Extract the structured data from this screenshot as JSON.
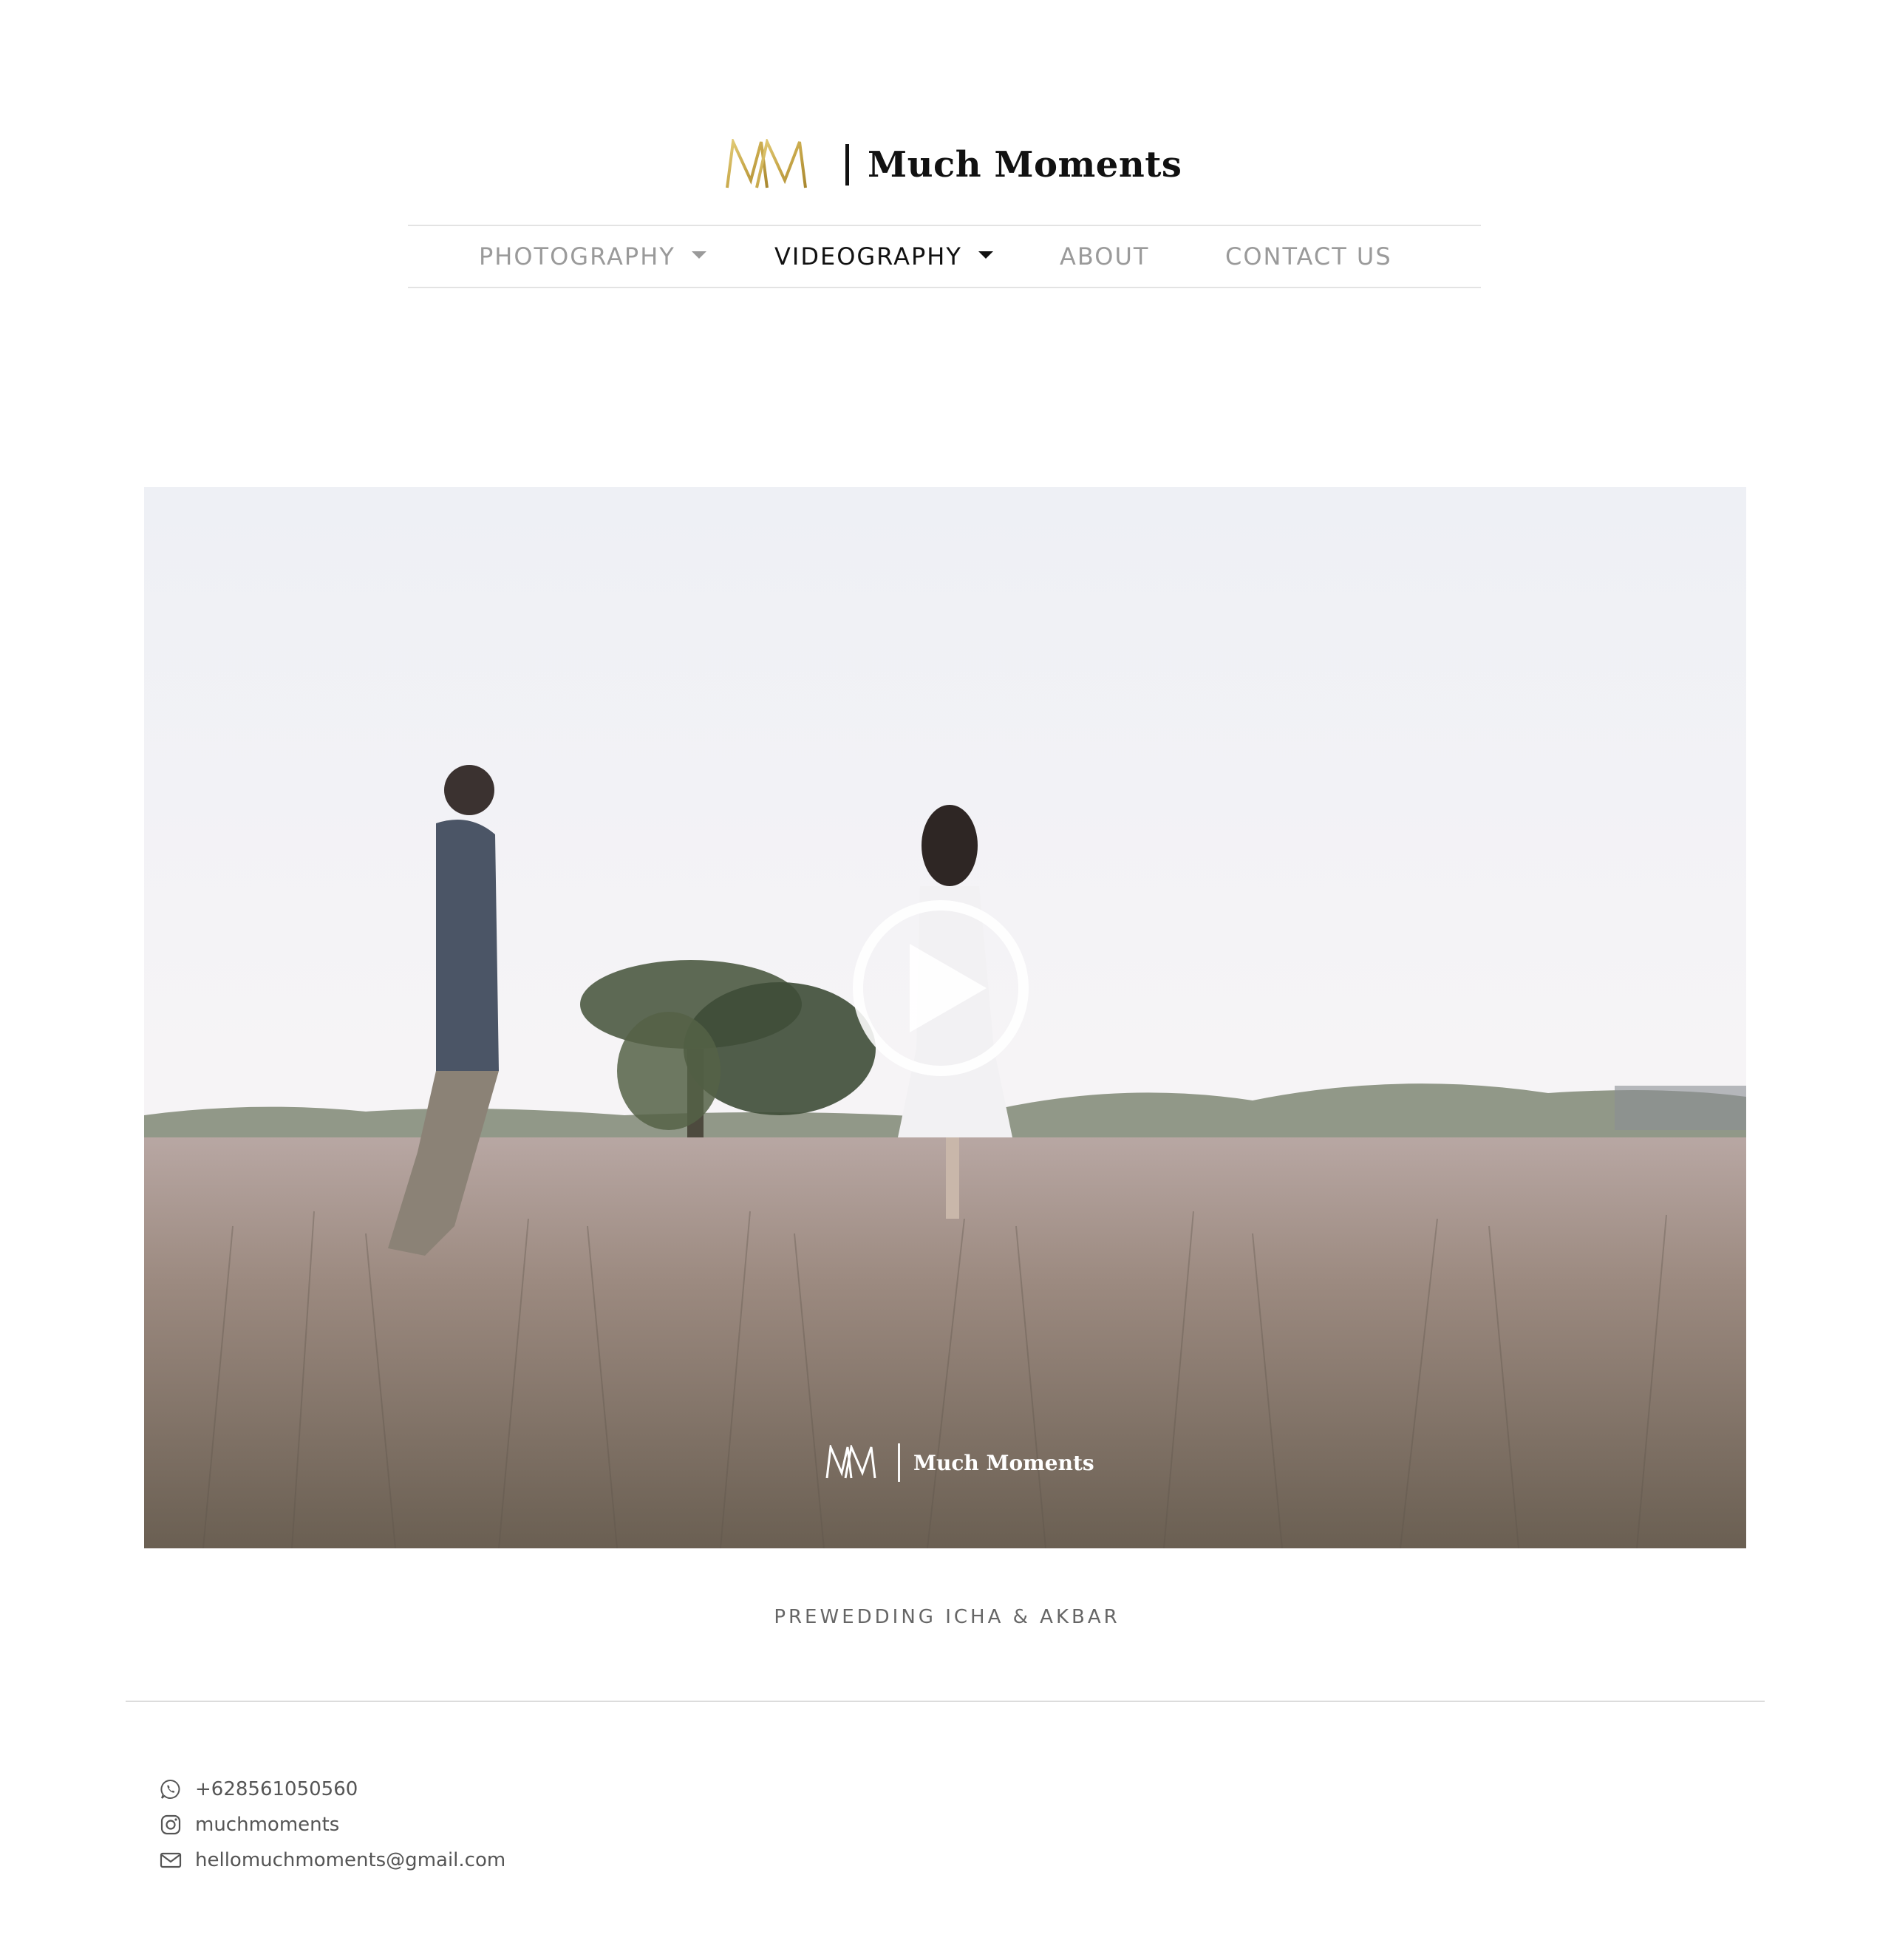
{
  "brand": {
    "name": "Much Moments",
    "logo_gold": "#c9a94b"
  },
  "nav": {
    "items": [
      {
        "label": "PHOTOGRAPHY",
        "dropdown": true,
        "active": false
      },
      {
        "label": "VIDEOGRAPHY",
        "dropdown": true,
        "active": true
      },
      {
        "label": "ABOUT",
        "dropdown": false,
        "active": false
      },
      {
        "label": "CONTACT US",
        "dropdown": false,
        "active": false
      }
    ]
  },
  "video": {
    "play_icon": "play-circle-icon",
    "watermark": "Much Moments"
  },
  "caption": "PREWEDDING ICHA & AKBAR",
  "footer": {
    "phone": {
      "icon": "whatsapp-icon",
      "text": "+628561050560"
    },
    "instagram": {
      "icon": "instagram-icon",
      "text": "muchmoments"
    },
    "email": {
      "icon": "mail-icon",
      "text": "hellomuchmoments@gmail.com"
    }
  }
}
